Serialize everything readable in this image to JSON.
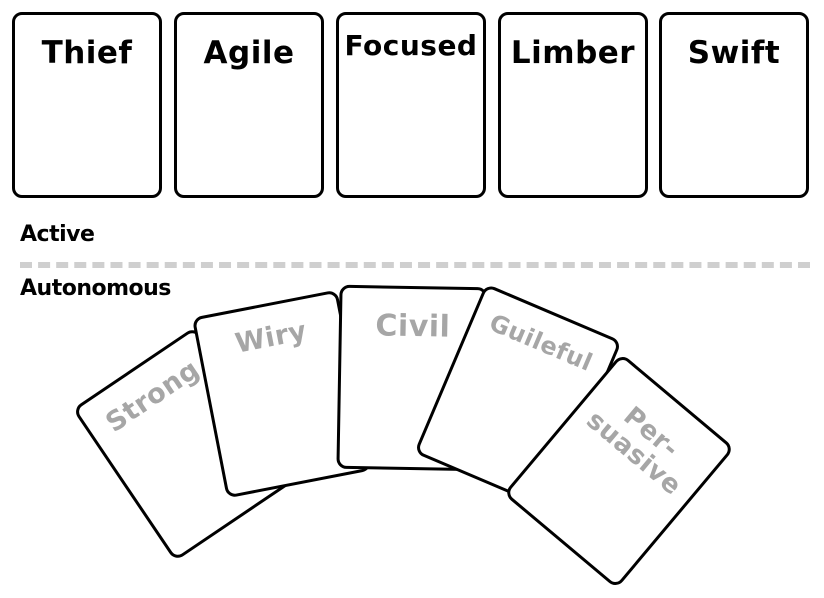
{
  "active_zone": {
    "label": "Active",
    "cards": [
      {
        "name": "Thief"
      },
      {
        "name": "Agile"
      },
      {
        "name": "Focused"
      },
      {
        "name": "Limber"
      },
      {
        "name": "Swift"
      }
    ]
  },
  "autonomous_zone": {
    "label": "Autonomous",
    "cards": [
      {
        "name": "Strong"
      },
      {
        "name": "Wiry"
      },
      {
        "name": "Civil"
      },
      {
        "name": "Guileful"
      },
      {
        "name": "Per-\nsuasive"
      }
    ]
  },
  "colors": {
    "card_border": "#000000",
    "inactive_text": "#a6a6a6",
    "divider": "#cfcfcf"
  }
}
